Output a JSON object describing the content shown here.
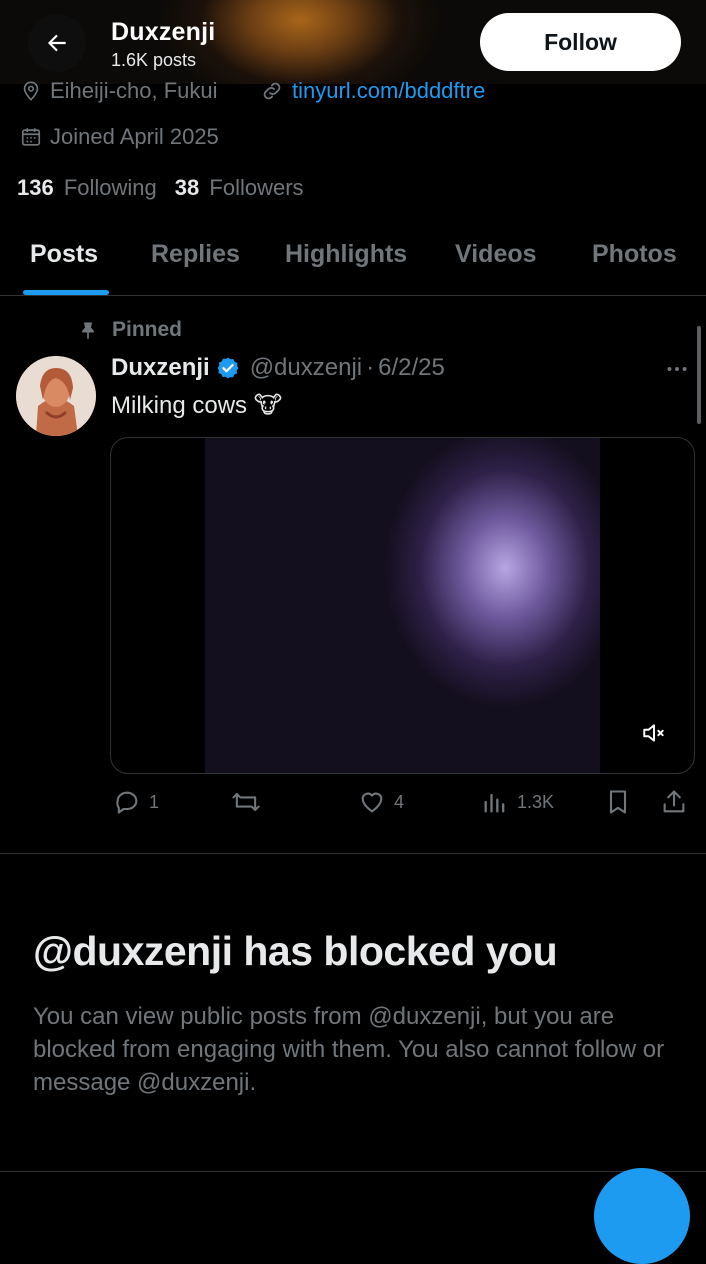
{
  "header": {
    "name": "Duxzenji",
    "posts_count": "1.6K posts",
    "follow_label": "Follow"
  },
  "profile": {
    "location": "Eiheiji-cho, Fukui",
    "website": "tinyurl.com/bdddftre",
    "joined": "Joined April 2025",
    "following_count": "136",
    "following_label": "Following",
    "followers_count": "38",
    "followers_label": "Followers"
  },
  "tabs": [
    {
      "label": "Posts",
      "active": true
    },
    {
      "label": "Replies"
    },
    {
      "label": "Highlights"
    },
    {
      "label": "Videos"
    },
    {
      "label": "Photos"
    }
  ],
  "post": {
    "pinned_label": "Pinned",
    "author_name": "Duxzenji",
    "handle": "@duxzenji",
    "separator": "·",
    "date": "6/2/25",
    "text": "Milking cows 🐮",
    "reply_count": "1",
    "like_count": "4",
    "views_count": "1.3K"
  },
  "blocked": {
    "title": "@duxzenji has blocked you",
    "description": "You can view public posts from @duxzenji, but you are blocked from engaging with them. You also cannot follow or message @duxzenji."
  },
  "colors": {
    "accent": "#1d9bf0",
    "background": "#000000",
    "text_primary": "#e7e9ea",
    "text_secondary": "#71767b",
    "divider": "#2f3336"
  }
}
